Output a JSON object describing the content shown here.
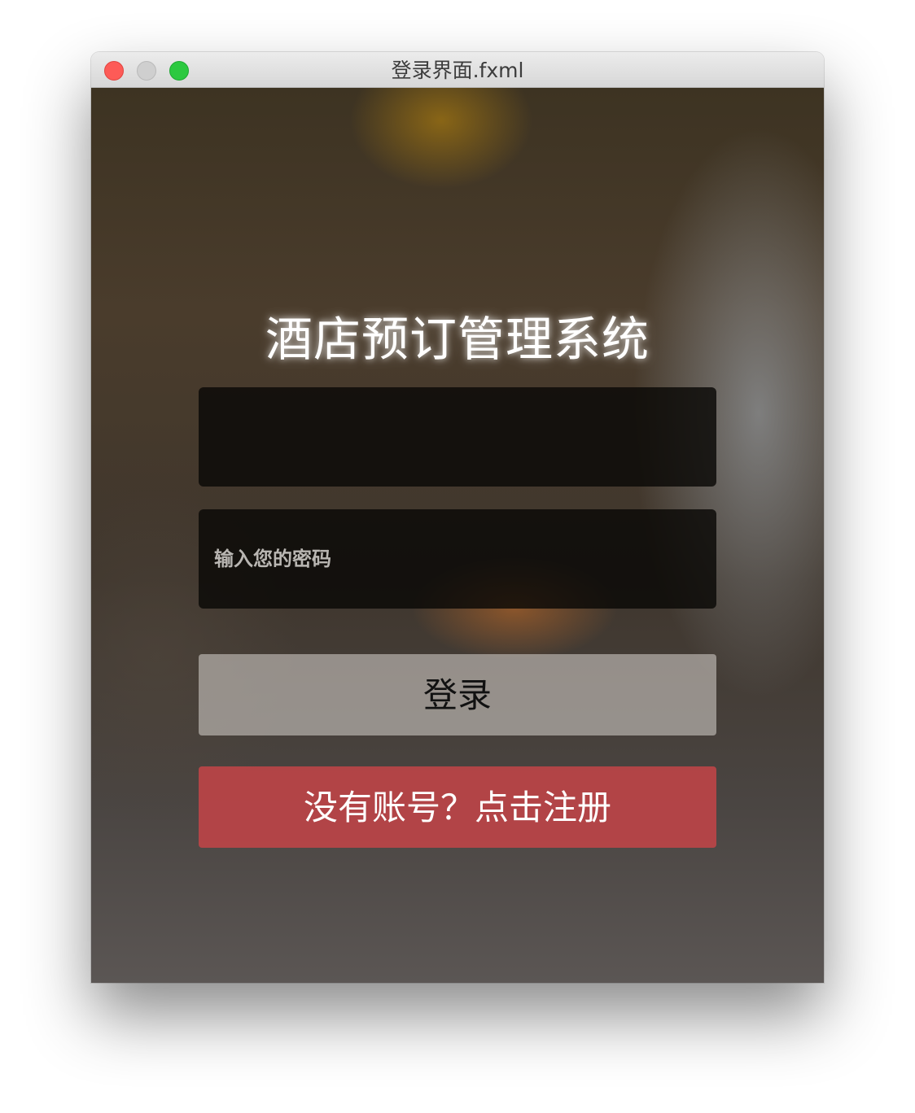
{
  "window": {
    "title": "登录界面.fxml"
  },
  "app": {
    "title": "酒店预订管理系统"
  },
  "form": {
    "username_value": "",
    "username_placeholder": "",
    "password_value": "",
    "password_placeholder": "输入您的密码",
    "login_label": "登录",
    "register_label": "没有账号？点击注册"
  },
  "colors": {
    "login_button": "#c8c3be",
    "register_button": "#c44448",
    "field_background": "#0a0806"
  }
}
